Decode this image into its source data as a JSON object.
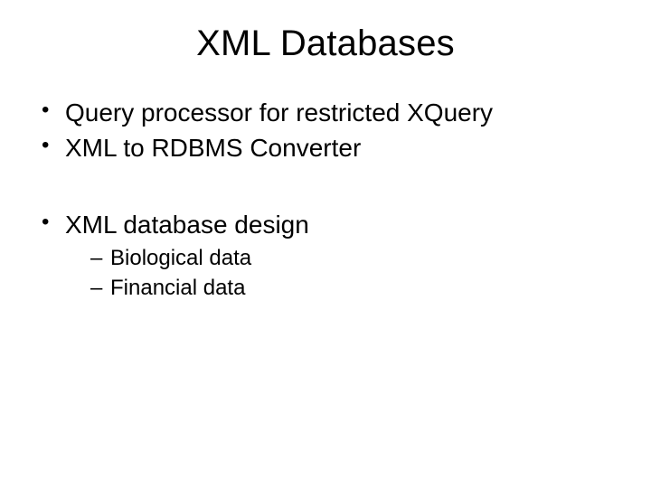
{
  "title": "XML Databases",
  "bullets": {
    "b1": "Query processor for restricted XQuery",
    "b2": "XML to RDBMS Converter",
    "b3": "XML database design",
    "b3_sub": {
      "s1": "Biological data",
      "s2": "Financial data"
    }
  }
}
